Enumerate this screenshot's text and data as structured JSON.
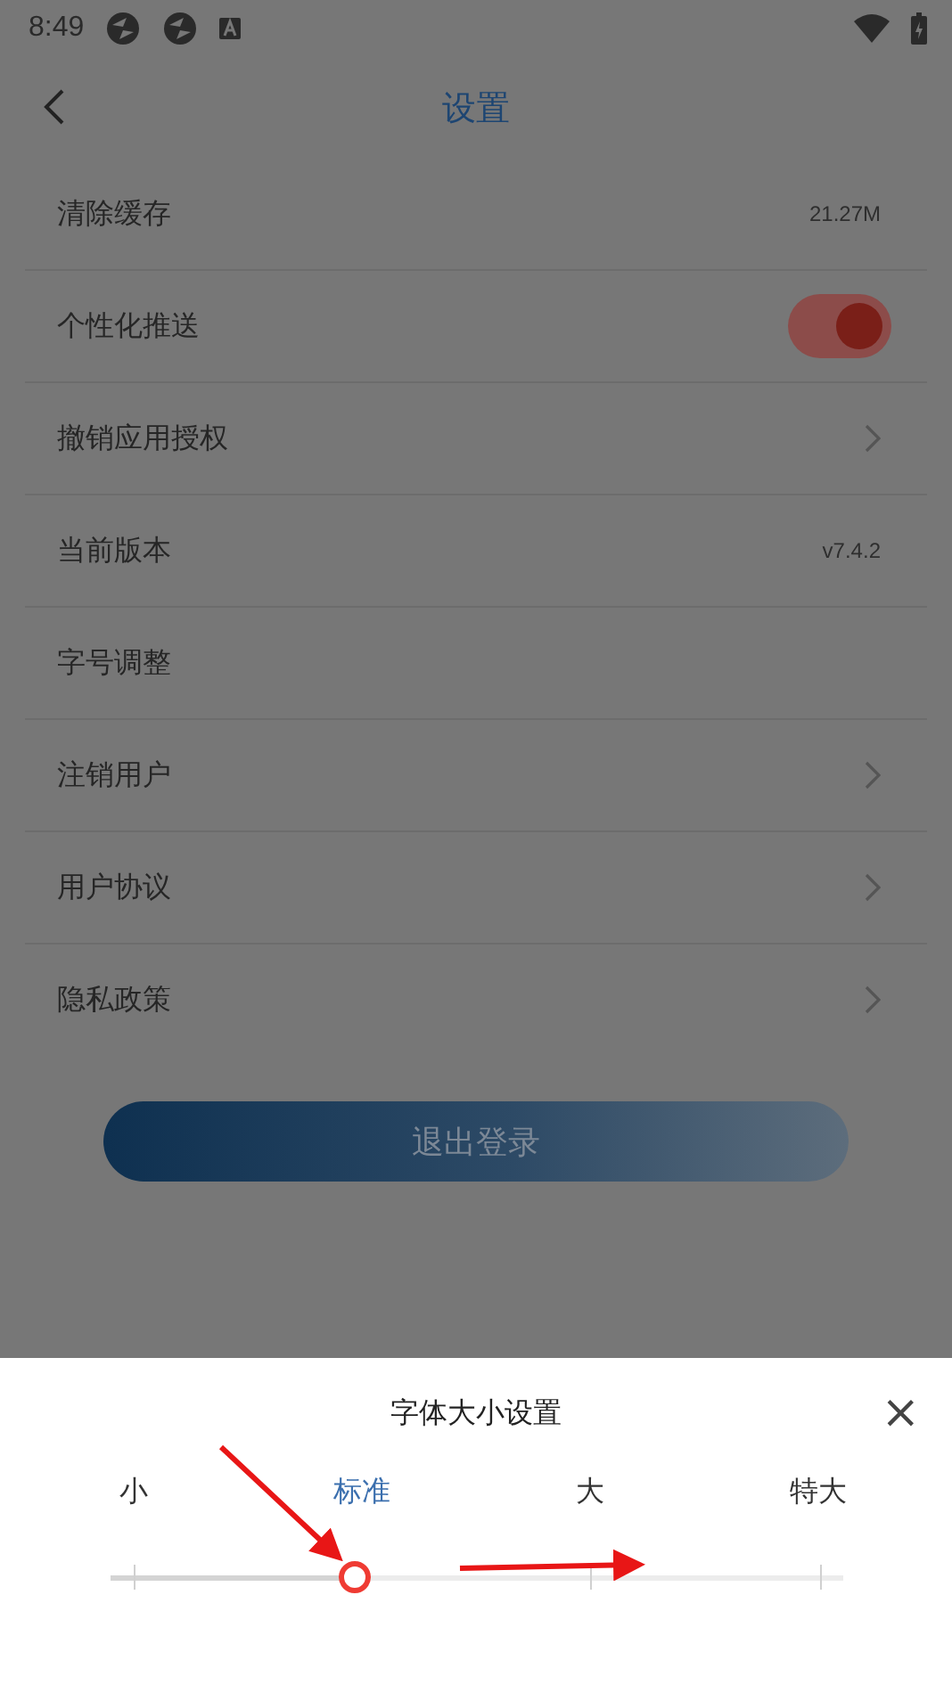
{
  "status_bar": {
    "time": "8:49"
  },
  "header": {
    "title": "设置"
  },
  "settings": [
    {
      "kind": "value",
      "label": "清除缓存",
      "value": "21.27M"
    },
    {
      "kind": "toggle",
      "label": "个性化推送",
      "on": true
    },
    {
      "kind": "link",
      "label": "撤销应用授权"
    },
    {
      "kind": "value",
      "label": "当前版本",
      "value": "v7.4.2"
    },
    {
      "kind": "plain",
      "label": "字号调整"
    },
    {
      "kind": "link",
      "label": "注销用户"
    },
    {
      "kind": "link",
      "label": "用户协议"
    },
    {
      "kind": "link",
      "label": "隐私政策"
    }
  ],
  "logout_button": "退出登录",
  "font_sheet": {
    "title": "字体大小设置",
    "close": "×",
    "options": [
      {
        "label": "小",
        "selected": false
      },
      {
        "label": "标准",
        "selected": true
      },
      {
        "label": "大",
        "selected": false
      },
      {
        "label": "特大",
        "selected": false
      }
    ],
    "slider": {
      "level": 0.333
    }
  }
}
